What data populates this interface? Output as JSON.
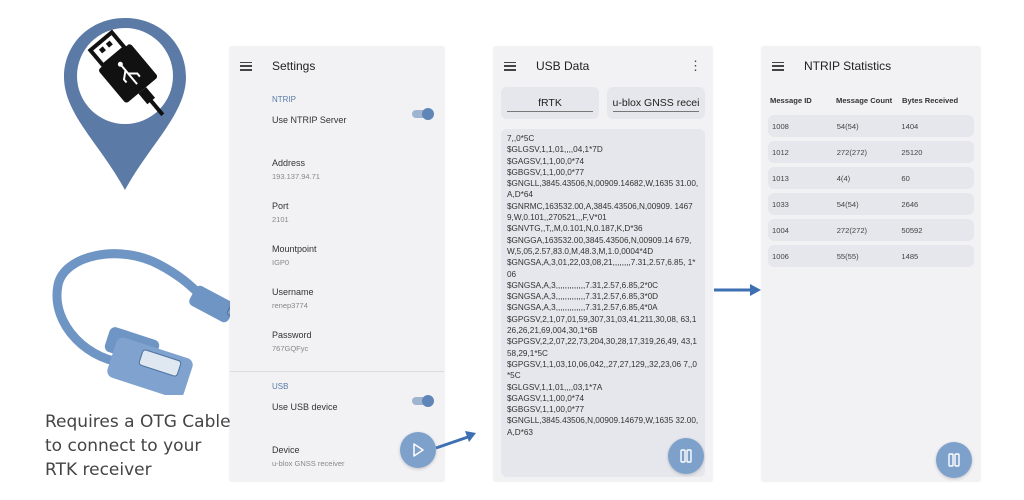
{
  "caption": {
    "line1": "Requires a OTG Cable",
    "line2": "to connect to your",
    "line3": "RTK receiver"
  },
  "settings": {
    "title": "Settings",
    "ntrip_section": "NTRIP",
    "use_ntrip": "Use NTRIP Server",
    "address_label": "Address",
    "address_value": "193.137.94.71",
    "port_label": "Port",
    "port_value": "2101",
    "mountpoint_label": "Mountpoint",
    "mountpoint_value": "IGP0",
    "username_label": "Username",
    "username_value": "renep3774",
    "password_label": "Password",
    "password_value": "767GQFyc",
    "usb_section": "USB",
    "use_usb": "Use USB device",
    "device_label": "Device",
    "device_value": "u-blox GNSS receiver"
  },
  "usb": {
    "title": "USB Data",
    "button1": "fRTK",
    "button2": "u-blox GNSS recei",
    "log": [
      "7,,0*5C",
      "$GLGSV,1,1,01,,,,04,1*7D",
      "$GAGSV,1,1,00,0*74",
      "$GBGSV,1,1,00,0*77",
      "$GNGLL,3845.43506,N,00909.14682,W,1635 31.00,A,D*64",
      "$GNRMC,163532.00,A,3845.43506,N,00909. 14679,W,0.101,,270521,,,F,V*01",
      "$GNVTG,,T,,M,0.101,N,0.187,K,D*36",
      "$GNGGA,163532.00,3845.43506,N,00909.14 679,W,5,05,2.57,83.0,M,48.3,M,1.0,0004*4D",
      "$GNGSA,A,3,01,22,03,08,21,,,,,,,,7.31,2.57,6.85, 1*06",
      "$GNGSA,A,3,,,,,,,,,,,,,7.31,2.57,6.85,2*0C",
      "$GNGSA,A,3,,,,,,,,,,,,,7.31,2.57,6.85,3*0D",
      "$GNGSA,A,3,,,,,,,,,,,,,7.31,2.57,6.85,4*0A",
      "$GPGSV,2,1,07,01,59,307,31,03,41,211,30,08, 63,126,26,21,69,004,30,1*6B",
      "$GPGSV,2,2,07,22,73,204,30,28,17,319,26,49, 43,158,29,1*5C",
      "$GPGSV,1,1,03,10,06,042,,27,27,129,,32,23,06 7,,0*5C",
      "$GLGSV,1,1,01,,,,03,1*7A",
      "$GAGSV,1,1,00,0*74",
      "$GBGSV,1,1,00,0*77",
      "$GNGLL,3845.43506,N,00909.14679,W,1635 32.00,A,D*63"
    ]
  },
  "ntrip": {
    "title": "NTRIP Statistics",
    "headers": [
      "Message ID",
      "Message Count",
      "Bytes Received"
    ],
    "rows": [
      [
        "1008",
        "54(54)",
        "1404"
      ],
      [
        "1012",
        "272(272)",
        "25120"
      ],
      [
        "1013",
        "4(4)",
        "60"
      ],
      [
        "1033",
        "54(54)",
        "2646"
      ],
      [
        "1004",
        "272(272)",
        "50592"
      ],
      [
        "1006",
        "55(55)",
        "1485"
      ]
    ]
  },
  "icons": {
    "logo": "usb-plug-map-pin-icon",
    "cable": "otg-cable-icon",
    "menu": "menu-icon",
    "more": "more-vertical-icon",
    "play": "play-icon",
    "pause": "pause-icon",
    "arrow": "arrow-right-icon"
  },
  "colors": {
    "accent": "#5f86b7",
    "fab": "#7ea1cc",
    "pin": "#5b7ba6",
    "arrow": "#3d6fb3"
  }
}
